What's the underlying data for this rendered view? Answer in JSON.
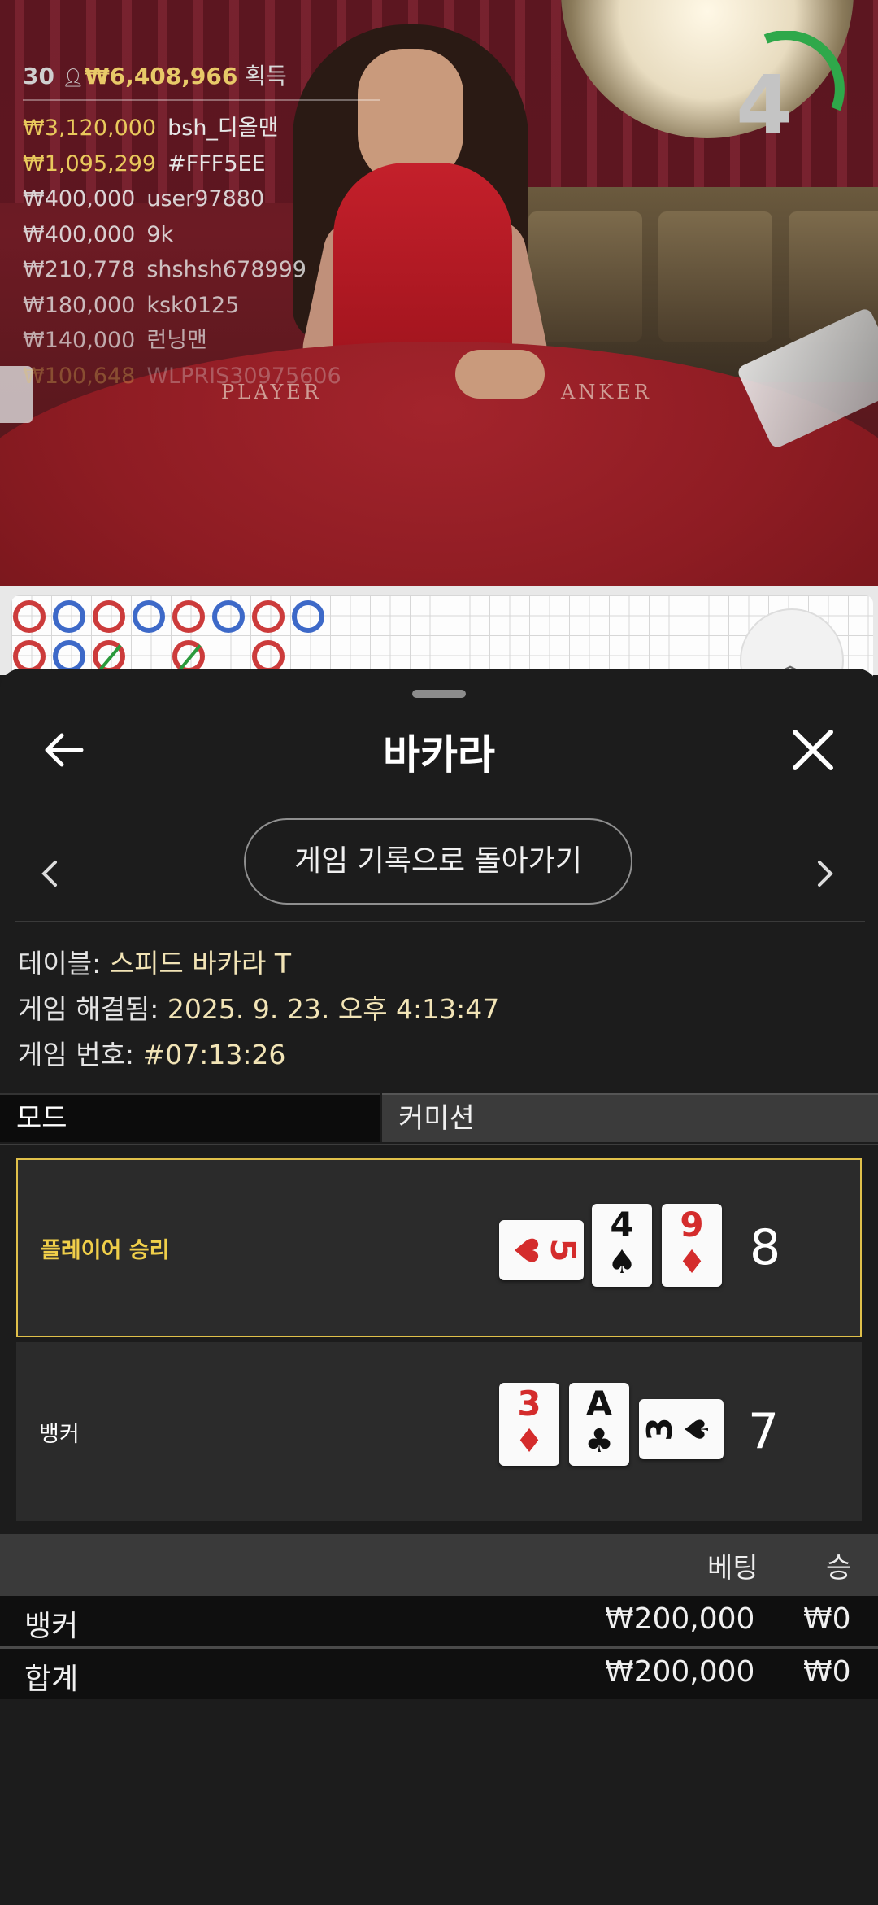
{
  "live": {
    "header": {
      "players": "30",
      "total": "₩6,408,966",
      "suffix": "획득"
    },
    "winners": [
      {
        "amount": "₩3,120,000",
        "name": "bsh_디올맨"
      },
      {
        "amount": "₩1,095,299",
        "name": "#FFF5EE"
      },
      {
        "amount": "₩400,000",
        "name": "user97880"
      },
      {
        "amount": "₩400,000",
        "name": "9k"
      },
      {
        "amount": "₩210,778",
        "name": "shshsh678999"
      },
      {
        "amount": "₩180,000",
        "name": "ksk0125"
      },
      {
        "amount": "₩140,000",
        "name": "런닝맨"
      },
      {
        "amount": "₩100,648",
        "name": "WLPRIS30975606"
      }
    ],
    "timer": "4",
    "table_labels": {
      "player": "PLAYER",
      "banker": "ANKER"
    }
  },
  "sheet": {
    "title": "바카라",
    "return_button": "게임 기록으로 돌아가기",
    "table_label": "테이블:",
    "table_value": "스피드 바카라 T",
    "resolved_label": "게임 해결됨:",
    "resolved_value": "2025. 9. 23. 오후 4:13:47",
    "game_no_label": "게임 번호:",
    "game_no_value": "#07:13:26",
    "tabs": {
      "mode": "모드",
      "commission": "커미션"
    },
    "player_hand": {
      "label": "플레이어 승리",
      "score": "8",
      "cards": [
        {
          "rank": "5",
          "suit": "♥"
        },
        {
          "rank": "4",
          "suit": "♠"
        },
        {
          "rank": "9",
          "suit": "♦"
        }
      ]
    },
    "banker_hand": {
      "label": "뱅커",
      "score": "7",
      "cards": [
        {
          "rank": "3",
          "suit": "♦"
        },
        {
          "rank": "A",
          "suit": "♣"
        },
        {
          "rank": "3",
          "suit": "♠"
        }
      ]
    },
    "bets": {
      "col_bet": "베팅",
      "col_win": "승",
      "rows": [
        {
          "label": "뱅커",
          "bet": "₩200,000",
          "win": "₩0"
        },
        {
          "label": "합계",
          "bet": "₩200,000",
          "win": "₩0"
        }
      ]
    }
  },
  "colors": {
    "winner_border": "#e0c04a",
    "winner_text": "#f0cf4a",
    "player_bead": "#3d69c8",
    "banker_bead": "#cc3b3b"
  }
}
